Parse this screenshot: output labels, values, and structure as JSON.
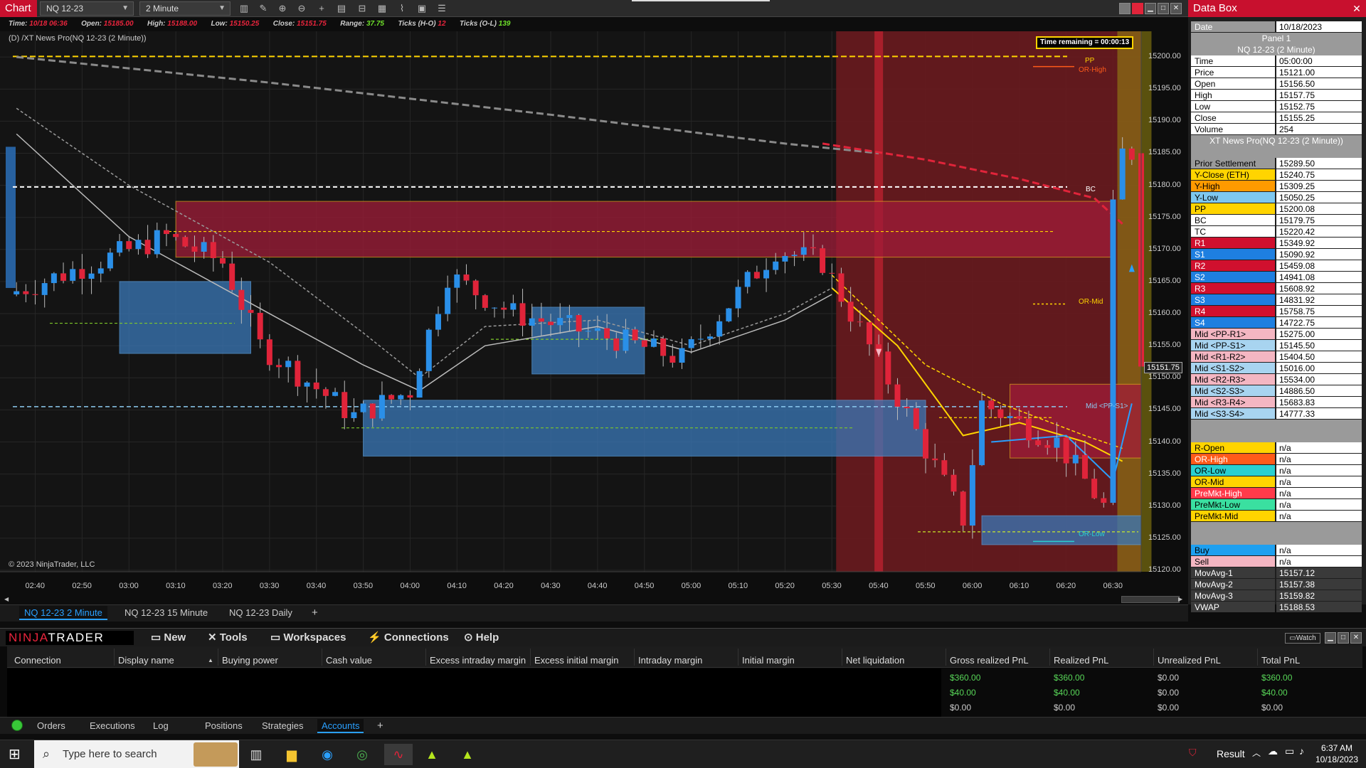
{
  "window": {
    "title": "Chart"
  },
  "toolbar": {
    "instrument": "NQ 12-23",
    "interval": "2 Minute"
  },
  "bar_info": {
    "time_label": "Time:",
    "time_value": "10/18 06:36",
    "open_label": "Open:",
    "open_value": "15185.00",
    "high_label": "High:",
    "high_value": "15188.00",
    "low_label": "Low:",
    "low_value": "15150.25",
    "close_label": "Close:",
    "close_value": "15151.75",
    "range_label": "Range:",
    "range_value": "37.75",
    "ticks_ho_label": "Ticks (H-O)",
    "ticks_ho_value": "12",
    "ticks_ol_label": "Ticks (O-L)",
    "ticks_ol_value": "139"
  },
  "indicator_label": "(D) /XT News Pro(NQ 12-23 (2 Minute))",
  "copyright": "© 2023 NinjaTrader, LLC",
  "time_remaining": "Time remaining = 00:00:13",
  "current_price": "15151.75",
  "price_ticks": [
    "15200.00",
    "15195.00",
    "15190.00",
    "15185.00",
    "15180.00",
    "15175.00",
    "15170.00",
    "15165.00",
    "15160.00",
    "15155.00",
    "15150.00",
    "15145.00",
    "15140.00",
    "15135.00",
    "15130.00",
    "15125.00",
    "15120.00"
  ],
  "time_ticks": [
    "02:40",
    "02:50",
    "03:00",
    "03:10",
    "03:20",
    "03:30",
    "03:40",
    "03:50",
    "04:00",
    "04:10",
    "04:20",
    "04:30",
    "04:40",
    "04:50",
    "05:00",
    "05:10",
    "05:20",
    "05:30",
    "05:40",
    "05:50",
    "06:00",
    "06:10",
    "06:20",
    "06:30"
  ],
  "level_labels": {
    "pp": "PP",
    "or_high": "OR-High",
    "bc": "BC",
    "or_mid": "OR-Mid",
    "mid_pp_s1": "Mid <PP-S1>",
    "or_low": "OR-Low"
  },
  "chart_tabs": [
    "NQ 12-23 2 Minute",
    "NQ 12-23 15 Minute",
    "NQ 12-23 Daily"
  ],
  "add_tab_label": "+",
  "colors": {
    "accent_red": "#c8102e",
    "bull": "#2a8fe8",
    "bear": "#e0243a",
    "session_red": "#8b1a1a",
    "highlight_blue": "#2aa0ff"
  },
  "chart_data": {
    "type": "candlestick",
    "instrument": "NQ 12-23",
    "interval": "2 Minute",
    "x_range": [
      "02:34",
      "06:36"
    ],
    "y_range": [
      15120,
      15204
    ],
    "pp": 15200.08,
    "bc": 15179.75,
    "mid_pp_s1": 15145.5,
    "or_high": 15198.5,
    "or_mid": 15161.5,
    "or_low": 15124.5,
    "last_bar": {
      "time": "06:36",
      "open": 15185.0,
      "high": 15188.0,
      "low": 15150.25,
      "close": 15151.75
    }
  },
  "databox": {
    "title": "Data Box",
    "rows_top": [
      {
        "k": "Date",
        "v": "10/18/2023"
      }
    ],
    "panel": "Panel 1",
    "series_header": "NQ 12-23 (2 Minute)",
    "ohlc": [
      {
        "k": "Time",
        "v": "05:00:00"
      },
      {
        "k": "Price",
        "v": "15121.00"
      },
      {
        "k": "Open",
        "v": "15156.50"
      },
      {
        "k": "High",
        "v": "15157.75"
      },
      {
        "k": "Low",
        "v": "15152.75"
      },
      {
        "k": "Close",
        "v": "15155.25"
      },
      {
        "k": "Volume",
        "v": "254"
      }
    ],
    "ind_header": "XT News Pro(NQ 12-23 (2 Minute))",
    "levels": [
      {
        "k": "Prior Settlement",
        "v": "15289.50",
        "bg": "#9a9a9a",
        "fg": "#000000"
      },
      {
        "k": "Y-Close (ETH)",
        "v": "15240.75",
        "bg": "#ffd400",
        "fg": "#000000"
      },
      {
        "k": "Y-High",
        "v": "15309.25",
        "bg": "#ff9a00",
        "fg": "#000000"
      },
      {
        "k": "Y-Low",
        "v": "15050.25",
        "bg": "#7ec8f0",
        "fg": "#000000"
      },
      {
        "k": "PP",
        "v": "15200.08",
        "bg": "#ffd400",
        "fg": "#000000"
      },
      {
        "k": "BC",
        "v": "15179.75",
        "bg": "#ffffff",
        "fg": "#000000"
      },
      {
        "k": "TC",
        "v": "15220.42",
        "bg": "#ffffff",
        "fg": "#000000"
      },
      {
        "k": "R1",
        "v": "15349.92",
        "bg": "#d0102e",
        "fg": "#ffffff"
      },
      {
        "k": "S1",
        "v": "15090.92",
        "bg": "#1e7fe0",
        "fg": "#ffffff"
      },
      {
        "k": "R2",
        "v": "15459.08",
        "bg": "#d0102e",
        "fg": "#ffffff"
      },
      {
        "k": "S2",
        "v": "14941.08",
        "bg": "#1e7fe0",
        "fg": "#ffffff"
      },
      {
        "k": "R3",
        "v": "15608.92",
        "bg": "#d0102e",
        "fg": "#ffffff"
      },
      {
        "k": "S3",
        "v": "14831.92",
        "bg": "#1e7fe0",
        "fg": "#ffffff"
      },
      {
        "k": "R4",
        "v": "15758.75",
        "bg": "#d0102e",
        "fg": "#ffffff"
      },
      {
        "k": "S4",
        "v": "14722.75",
        "bg": "#1e7fe0",
        "fg": "#ffffff"
      },
      {
        "k": "Mid <PP-R1>",
        "v": "15275.00",
        "bg": "#f4b6c2",
        "fg": "#000000"
      },
      {
        "k": "Mid <PP-S1>",
        "v": "15145.50",
        "bg": "#a8d4f0",
        "fg": "#000000"
      },
      {
        "k": "Mid <R1-R2>",
        "v": "15404.50",
        "bg": "#f4b6c2",
        "fg": "#000000"
      },
      {
        "k": "Mid <S1-S2>",
        "v": "15016.00",
        "bg": "#a8d4f0",
        "fg": "#000000"
      },
      {
        "k": "Mid <R2-R3>",
        "v": "15534.00",
        "bg": "#f4b6c2",
        "fg": "#000000"
      },
      {
        "k": "Mid <S2-S3>",
        "v": "14886.50",
        "bg": "#a8d4f0",
        "fg": "#000000"
      },
      {
        "k": "Mid <R3-R4>",
        "v": "15683.83",
        "bg": "#f4b6c2",
        "fg": "#000000"
      },
      {
        "k": "Mid <S3-S4>",
        "v": "14777.33",
        "bg": "#a8d4f0",
        "fg": "#000000"
      }
    ],
    "opening": [
      {
        "k": "R-Open",
        "v": "n/a",
        "bg": "#ffd400",
        "fg": "#000000"
      },
      {
        "k": "OR-High",
        "v": "n/a",
        "bg": "#ff5a1a",
        "fg": "#ffffff"
      },
      {
        "k": "OR-Low",
        "v": "n/a",
        "bg": "#2ad0d0",
        "fg": "#000000"
      },
      {
        "k": "OR-Mid",
        "v": "n/a",
        "bg": "#ffd400",
        "fg": "#000000"
      },
      {
        "k": "PreMkt-High",
        "v": "n/a",
        "bg": "#ff3a4a",
        "fg": "#ffffff"
      },
      {
        "k": "PreMkt-Low",
        "v": "n/a",
        "bg": "#3ae0a0",
        "fg": "#000000"
      },
      {
        "k": "PreMkt-Mid",
        "v": "n/a",
        "bg": "#ffd400",
        "fg": "#000000"
      }
    ],
    "flow": [
      {
        "k": "Buy",
        "v": "n/a",
        "bg": "#1ea0f0",
        "fg": "#000000"
      },
      {
        "k": "Sell",
        "v": "n/a",
        "bg": "#f4b6c2",
        "fg": "#000000"
      },
      {
        "k": "MovAvg-1",
        "v": "15157.12",
        "bg": "#3a3a3a",
        "fg": "#ffffff"
      },
      {
        "k": "MovAvg-2",
        "v": "15157.38",
        "bg": "#3a3a3a",
        "fg": "#ffffff"
      },
      {
        "k": "MovAvg-3",
        "v": "15159.82",
        "bg": "#3a3a3a",
        "fg": "#ffffff"
      },
      {
        "k": "VWAP",
        "v": "15188.53",
        "bg": "#3a3a3a",
        "fg": "#ffffff"
      }
    ]
  },
  "control_center": {
    "logo_a": "NINJA",
    "logo_b": "TRADER",
    "menu": [
      {
        "label": "New",
        "icon": "new-icon"
      },
      {
        "label": "Tools",
        "icon": "tools-icon"
      },
      {
        "label": "Workspaces",
        "icon": "workspaces-icon"
      },
      {
        "label": "Connections",
        "icon": "connections-icon"
      },
      {
        "label": "Help",
        "icon": "help-icon"
      }
    ],
    "watch_label": "Watch",
    "columns": [
      "Connection",
      "Display name",
      "Buying power",
      "Cash value",
      "Excess intraday margin",
      "Excess initial margin",
      "Intraday margin",
      "Initial margin",
      "Net liquidation",
      "Gross realized PnL",
      "Realized PnL",
      "Unrealized PnL",
      "Total PnL"
    ],
    "rows": [
      {
        "gross": "$360.00",
        "realized": "$360.00",
        "unrealized": "$0.00",
        "total": "$360.00"
      },
      {
        "gross": "$40.00",
        "realized": "$40.00",
        "unrealized": "$0.00",
        "total": "$40.00"
      },
      {
        "gross": "$0.00",
        "realized": "$0.00",
        "unrealized": "$0.00",
        "total": "$0.00"
      }
    ],
    "tabs": [
      "Orders",
      "Executions",
      "Log",
      "Positions",
      "Strategies",
      "Accounts"
    ],
    "add_tab": "+"
  },
  "taskbar": {
    "search_placeholder": "Type here to search",
    "result_label": "Result",
    "time": "6:37 AM",
    "date": "10/18/2023"
  }
}
